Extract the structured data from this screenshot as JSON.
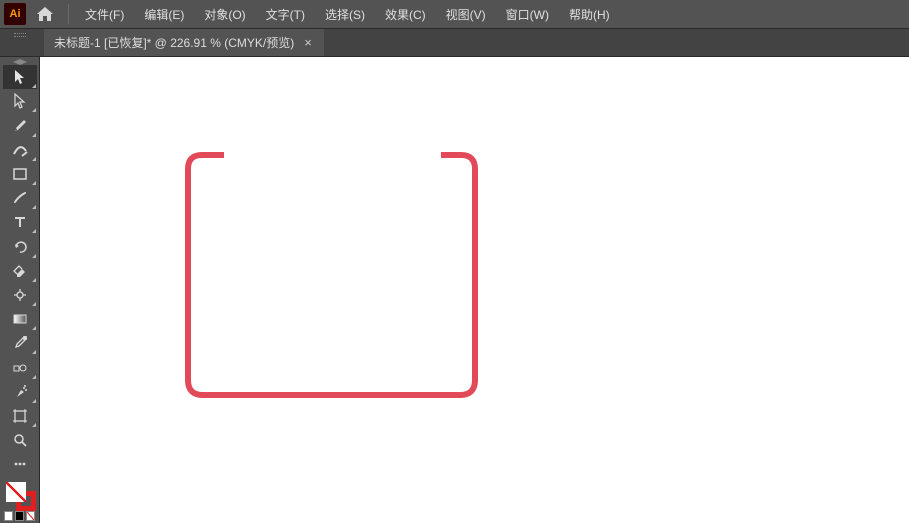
{
  "app": {
    "logo_text": "Ai"
  },
  "menu": {
    "file": "文件(F)",
    "edit": "编辑(E)",
    "object": "对象(O)",
    "type": "文字(T)",
    "select": "选择(S)",
    "effect": "效果(C)",
    "view": "视图(V)",
    "window": "窗口(W)",
    "help": "帮助(H)"
  },
  "tab": {
    "title": "未标题-1 [已恢复]* @ 226.91 % (CMYK/预览)",
    "close_glyph": "×"
  },
  "tools": {
    "selection": "selection-tool",
    "direct_select": "direct-selection-tool",
    "pen": "pen-tool",
    "curvature": "curvature-tool",
    "rectangle": "rectangle-tool",
    "brush": "brush-tool",
    "type": "type-tool",
    "rotate": "rotate-tool",
    "eraser": "eraser-tool",
    "scale": "scale-tool",
    "gradient": "gradient-tool",
    "eyedropper": "eyedropper-tool",
    "blend": "blend-tool",
    "symbol": "symbol-sprayer-tool",
    "artboard": "artboard-tool",
    "zoom": "zoom-tool",
    "hand": "hand-tool"
  },
  "swatches": {
    "fill": "none",
    "stroke": "#e02020"
  },
  "canvas": {
    "artwork_stroke": "#e24a59",
    "artwork_stroke_width": 6
  }
}
